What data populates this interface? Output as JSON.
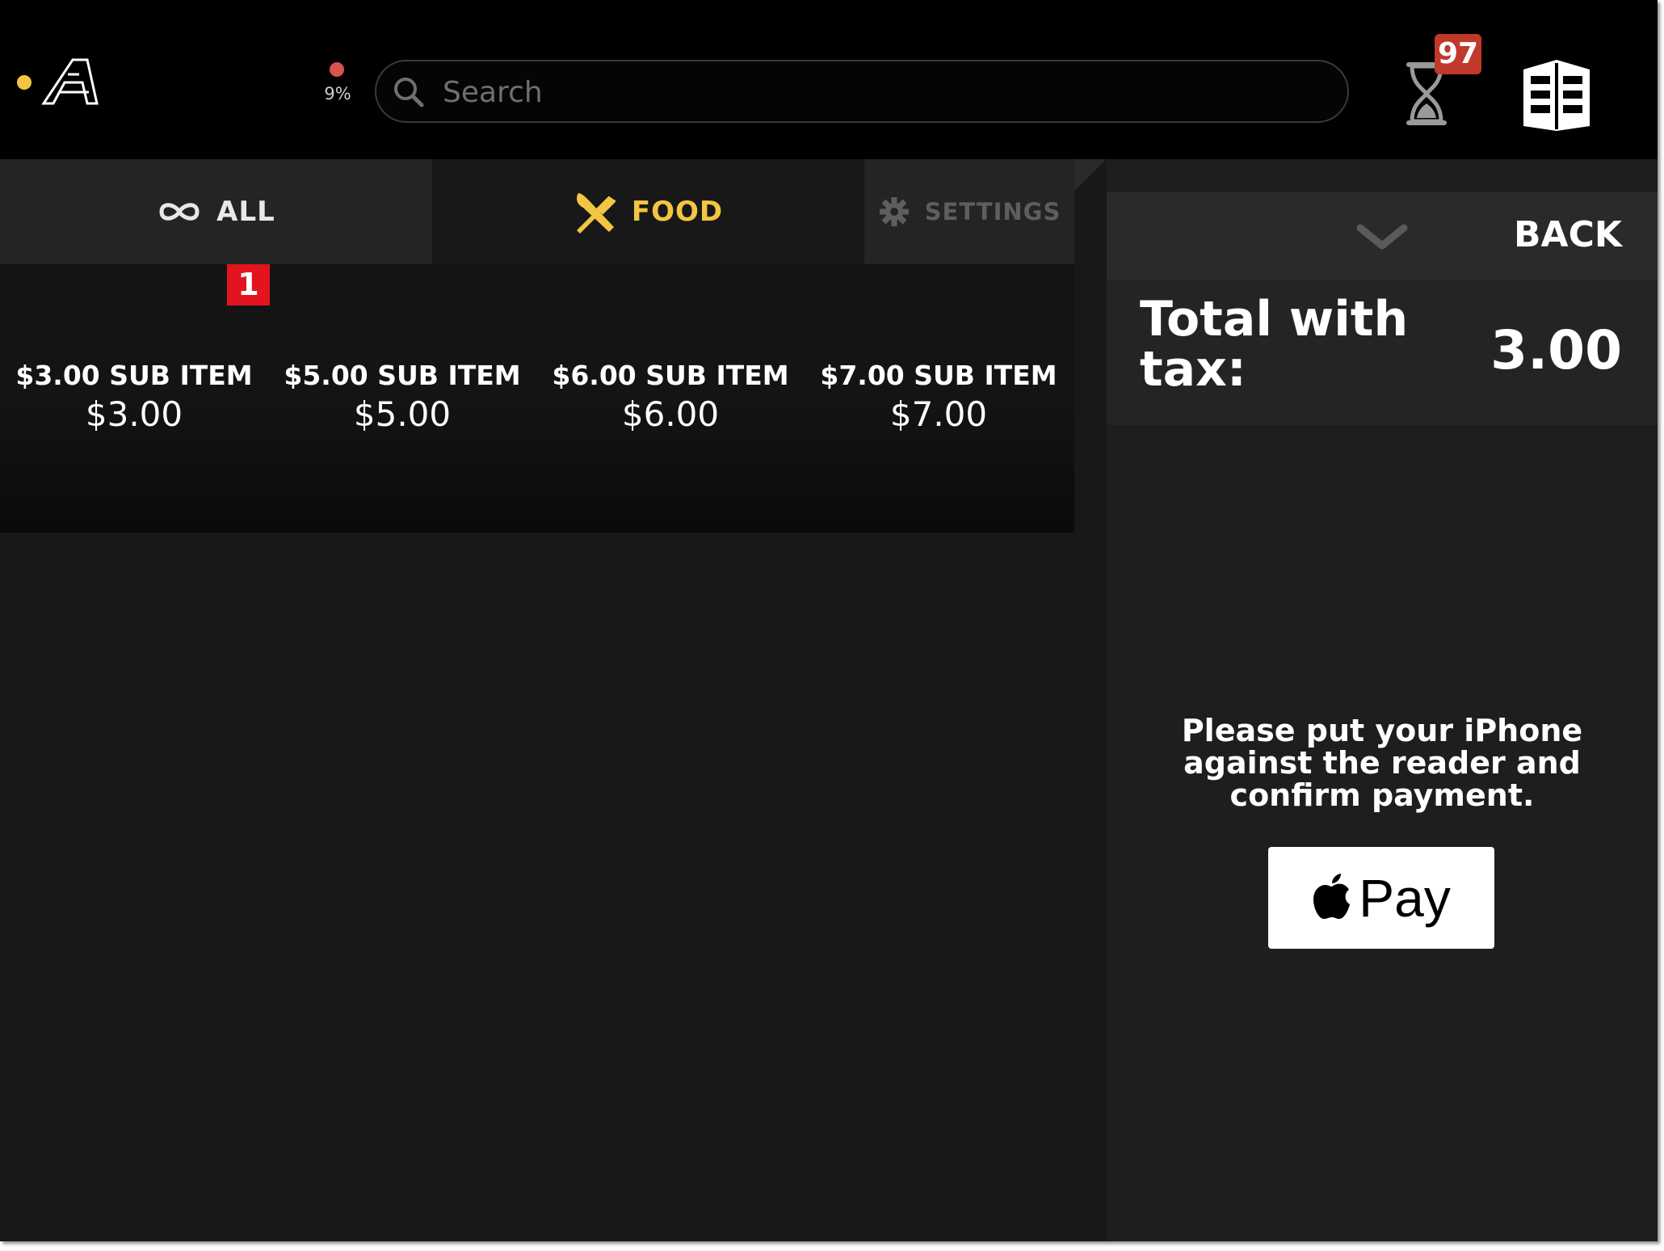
{
  "topbar": {
    "battery_percent": "9%",
    "search_placeholder": "Search",
    "pending_count": "97"
  },
  "tabs": [
    {
      "label": "ALL",
      "icon": "infinity-icon",
      "selected": false
    },
    {
      "label": "FOOD",
      "icon": "fork-knife-icon",
      "selected": true
    },
    {
      "label": "SETTINGS",
      "icon": "gear-icon",
      "selected": false
    }
  ],
  "items": [
    {
      "name": "$3.00 SUB ITEM",
      "price": "$3.00",
      "quantity": "1"
    },
    {
      "name": "$5.00 SUB ITEM",
      "price": "$5.00"
    },
    {
      "name": "$6.00 SUB ITEM",
      "price": "$6.00"
    },
    {
      "name": "$7.00 SUB ITEM",
      "price": "$7.00"
    }
  ],
  "panel": {
    "back_label": "BACK",
    "total_label": "Total with tax:",
    "total_value": "3.00",
    "payment_message": "Please put your iPhone against the reader and confirm payment.",
    "apple_pay_label": "Pay"
  },
  "colors": {
    "accent": "#f4c542",
    "badge_red": "#c0392b",
    "qty_red": "#e3141e",
    "battery_dot": "#d9534f"
  }
}
